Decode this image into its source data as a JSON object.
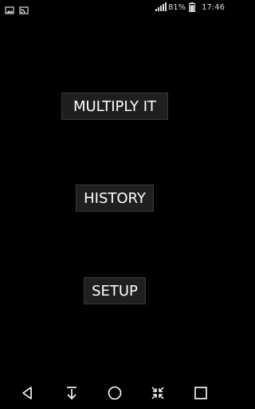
{
  "status_bar": {
    "battery": "81%",
    "time": "17:46",
    "left_icons": [
      "image-icon",
      "cast-icon"
    ],
    "right_icons": [
      "signal-icon",
      "battery-icon"
    ]
  },
  "menu": {
    "multiply_label": "MULTIPLY IT",
    "history_label": "HISTORY",
    "setup_label": "SETUP"
  },
  "nav_bar": {
    "icons": [
      "back-icon",
      "download-icon",
      "home-icon",
      "compress-icon",
      "recents-icon"
    ]
  },
  "colors": {
    "background": "#000000",
    "button_bg": "#1f1f1f",
    "button_border": "#3a3a3a",
    "text": "#ffffff"
  }
}
